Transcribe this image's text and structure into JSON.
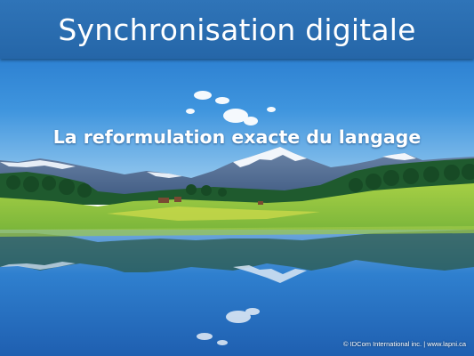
{
  "slide": {
    "title": "Synchronisation digitale",
    "subtitle": "La reformulation exacte du langage",
    "copyright": "© IDCom International inc. | www.lapni.ca"
  },
  "colors": {
    "title_bar": "#2a6db2",
    "sky": "#2a86d6",
    "meadow": "#7fbf3a",
    "lake": "#1f6fbf"
  },
  "background": {
    "scene": "alpine-lake-with-mountain-reflection"
  }
}
